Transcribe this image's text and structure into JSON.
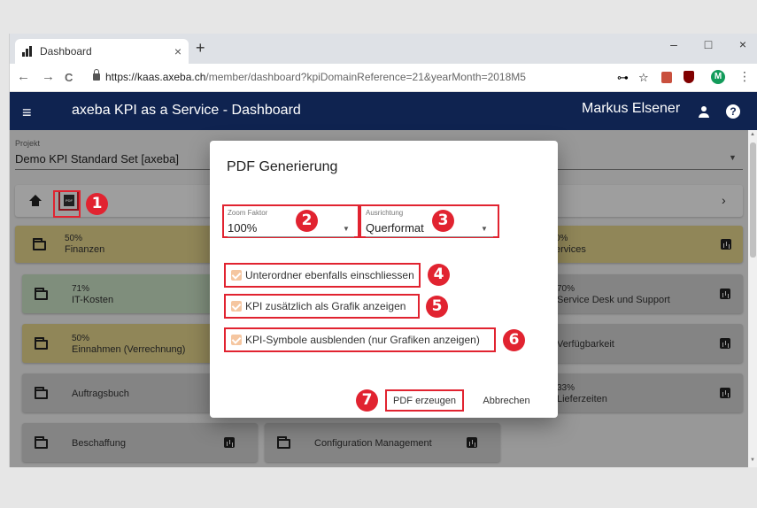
{
  "browser": {
    "tab_title": "Dashboard",
    "tab_close": "×",
    "new_tab": "+",
    "minimize": "–",
    "maximize": "□",
    "close": "×",
    "back": "←",
    "forward": "→",
    "reload": "C",
    "url_host": "https://kaas.axeba.ch",
    "url_path": "/member/dashboard?kpiDomainReference=21&yearMonth=2018M5",
    "key_icon": "⊶",
    "star_icon": "☆",
    "profile_initial": "M",
    "menu_icon": "⋮"
  },
  "appbar": {
    "title": "axeba KPI as a Service  -  Dashboard",
    "user": "Markus Elsener",
    "help": "?"
  },
  "project": {
    "label": "Projekt",
    "value": "Demo KPI Standard Set [axeba]"
  },
  "toolbar": {
    "pdf_icon_text": "PDF",
    "next": "›"
  },
  "tiles_left": [
    {
      "pct": "50%",
      "name": "Finanzen"
    },
    {
      "pct": "71%",
      "name": "IT-Kosten"
    },
    {
      "pct": "50%",
      "name": "Einnahmen (Verrechnung)"
    },
    {
      "pct": "",
      "name": "Auftragsbuch"
    },
    {
      "pct": "",
      "name": "Beschaffung"
    }
  ],
  "tiles_mid": [
    {
      "pct": "",
      "name": "Configuration Management"
    }
  ],
  "tiles_right": [
    {
      "pct": "0%",
      "name": "ervices"
    },
    {
      "pct": "70%",
      "name": "Service Desk und Support"
    },
    {
      "pct": "",
      "name": "Verfügbarkeit"
    },
    {
      "pct": "33%",
      "name": "Lieferzeiten"
    }
  ],
  "dialog": {
    "title": "PDF Generierung",
    "zoom_label": "Zoom Faktor",
    "zoom_value": "100%",
    "orientation_label": "Ausrichtung",
    "orientation_value": "Querformat",
    "cb_subfolders": "Unterordner ebenfalls einschliessen",
    "cb_graphic": "KPI zusätzlich als Grafik anzeigen",
    "cb_hide_symbols": "KPI-Symbole ausblenden (nur Grafiken anzeigen)",
    "btn_create": "PDF erzeugen",
    "btn_cancel": "Abbrechen"
  },
  "markers": [
    "1",
    "2",
    "3",
    "4",
    "5",
    "6",
    "7"
  ],
  "colors": {
    "appbar": "#0f2350",
    "highlight": "#e12330",
    "tile_yellow": "#e8d98f",
    "tile_grey": "#d5d5d5",
    "checkbox": "#f5c6a0"
  }
}
